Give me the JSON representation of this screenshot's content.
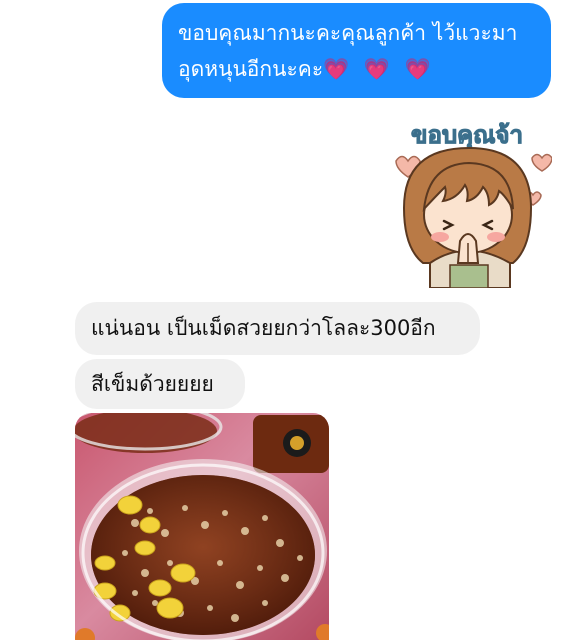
{
  "messages": {
    "outgoing": {
      "line1": "ขอบคุณมากนะคะคุณลูกค้า ไว้แวะมา",
      "line2": "อุดหนุนอีกนะคะ",
      "hearts": "💗 💗 💗"
    },
    "incoming": [
      {
        "text": "แน่นอน เป็นเม็ดสวยยกว่าโลละ300อีก"
      },
      {
        "text": "สีเข็มด้วยยยย"
      }
    ]
  },
  "sticker": {
    "caption": "ขอบคุณจ้า",
    "icon": "thank-you-girl-sticker"
  },
  "photo": {
    "icon": "dessert-photo"
  },
  "colors": {
    "outgoing_bubble": "#1a8cff",
    "incoming_bubble": "#f0f0f0",
    "heart": "#e4479b"
  }
}
